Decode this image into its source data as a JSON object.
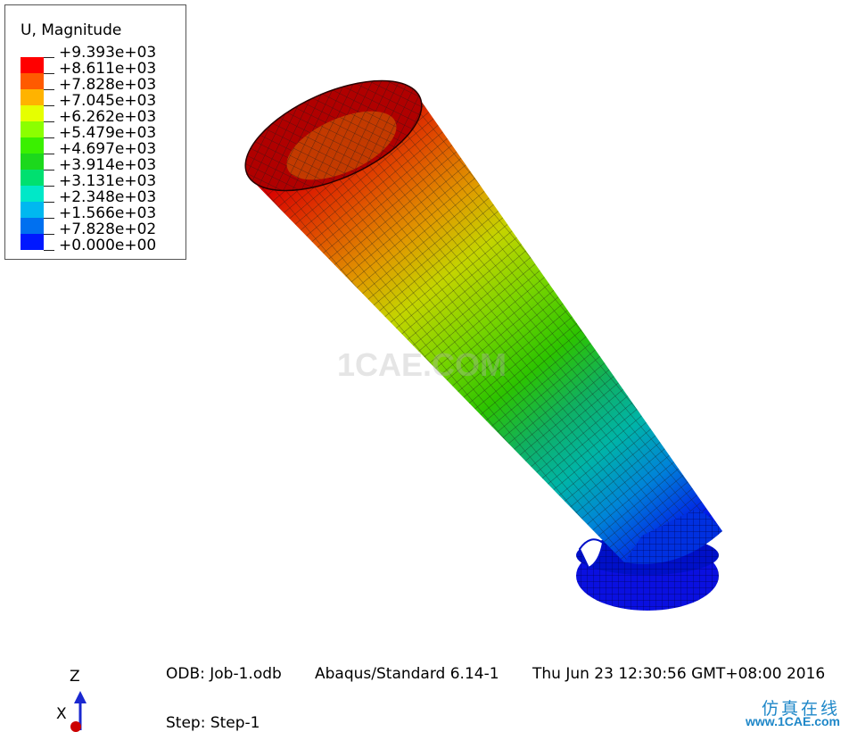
{
  "legend": {
    "title": "U, Magnitude",
    "labels": [
      "+9.393e+03",
      "+8.611e+03",
      "+7.828e+03",
      "+7.045e+03",
      "+6.262e+03",
      "+5.479e+03",
      "+4.697e+03",
      "+3.914e+03",
      "+3.131e+03",
      "+2.348e+03",
      "+1.566e+03",
      "+7.828e+02",
      "+0.000e+00"
    ],
    "colors": [
      "#ff0000",
      "#ff5a00",
      "#ffb300",
      "#e6ff00",
      "#8cff00",
      "#3af000",
      "#1cd81c",
      "#00e070",
      "#00e8c8",
      "#00b8f0",
      "#0070f0",
      "#0018ff"
    ]
  },
  "footer": {
    "odb": "ODB: Job-1.odb",
    "solver": "Abaqus/Standard 6.14-1",
    "datetime": "Thu Jun 23 12:30:56 GMT+08:00 2016",
    "step": "Step: Step-1"
  },
  "triad": {
    "z_label": "Z",
    "x_label": "X"
  },
  "watermark": {
    "text": "1CAE.COM",
    "brand_cn": "仿真在线",
    "brand_url": "www.1CAE.com"
  }
}
